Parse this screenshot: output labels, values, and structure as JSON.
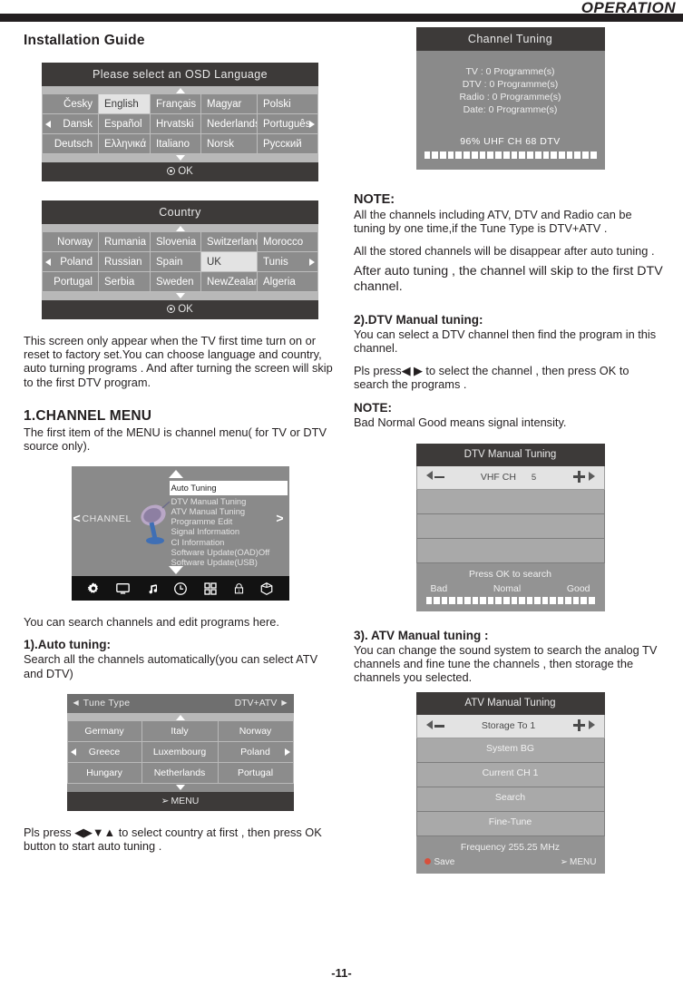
{
  "header": {
    "title": "OPERATION"
  },
  "page_number": "-11-",
  "left": {
    "section_title": "Installation Guide",
    "language_panel": {
      "title": "Please select an OSD Language",
      "rows": [
        [
          "Česky",
          "English",
          "Français",
          "Magyar",
          "Polski"
        ],
        [
          "Dansk",
          "Español",
          "Hrvatski",
          "Nederlands",
          "Português"
        ],
        [
          "Deutsch",
          "Ελληνικά",
          "Italiano",
          "Norsk",
          "Русский"
        ]
      ],
      "selected": "English",
      "ok_label": "OK"
    },
    "country_panel": {
      "title": "Country",
      "rows": [
        [
          "Norway",
          "Rumania",
          "Slovenia",
          "Switzerland",
          "Morocco"
        ],
        [
          "Poland",
          "Russian",
          "Spain",
          "UK",
          "Tunis"
        ],
        [
          "Portugal",
          "Serbia",
          "Sweden",
          "NewZealand",
          "Algeria"
        ]
      ],
      "selected": "UK",
      "ok_label": "OK"
    },
    "intro_paragraph": "This screen only appear when the TV first time turn on or reset to factory set.You can choose language and country, auto turning programs . And after turning the screen will  skip to the first DTV program.",
    "channel_menu_heading": "1.CHANNEL MENU",
    "channel_menu_intro": "The first item of the MENU is channel menu( for TV or DTV source only).",
    "channel_menu_osd": {
      "left_label": "CHANNEL",
      "items": [
        "Auto Tuning",
        "DTV Manual Tuning",
        "ATV Manual Tuning",
        "Programme Edit",
        "Signal Information",
        "CI Information",
        "Software Update(OAD)Off",
        "Software Update(USB)"
      ],
      "selected": "Auto Tuning",
      "icons": [
        "gear-icon",
        "screen-icon",
        "music-note-icon",
        "clock-icon",
        "grid-icon",
        "lock-icon",
        "cube-icon"
      ]
    },
    "after_menu_text": "You can search  channels and edit programs  here.",
    "auto_tuning_heading": "1).Auto tuning:",
    "auto_tuning_text": "Search all the channels automatically(you can select ATV and DTV)",
    "tune_type_panel": {
      "label": "Tune Type",
      "value": "DTV+ATV",
      "rows": [
        [
          "Germany",
          "Italy",
          "Norway"
        ],
        [
          "Greece",
          "Luxembourg",
          "Poland"
        ],
        [
          "Hungary",
          "Netherlands",
          "Portugal"
        ]
      ],
      "menu_label": "MENU"
    },
    "closing_text": "Pls press ◀▶▼▲ to select  country at first , then press OK button to start auto tuning ."
  },
  "right": {
    "channel_tuning_panel": {
      "title": "Channel Tuning",
      "lines": [
        "TV   : 0 Programme(s)",
        "DTV : 0 Programme(s)",
        "Radio : 0 Programme(s)",
        "Date:  0 Programme(s)"
      ],
      "status": "96%   UHF   CH   68 DTV",
      "progress_percent": 96
    },
    "note1_heading": "NOTE:",
    "note1_text": "All the channels including ATV,  DTV and Radio can be tuning by one time,if the Tune Type is DTV+ATV .",
    "note2_text": "All the stored channels will be disappear after auto tuning .",
    "note3_text": "After auto tuning , the channel will skip to the first DTV channel.",
    "dtv_heading": "2).DTV Manual tuning:",
    "dtv_text": "You can select a DTV channel then  find the program in this channel.",
    "dtv_press_text": "Pls press◀ ▶ to select the channel , then press OK to search the programs .",
    "note4_heading": "NOTE:",
    "note4_text": "Bad Normal Good means signal intensity.",
    "dtv_manual_panel": {
      "title": "DTV Manual Tuning",
      "active_label": "VHF CH",
      "active_value": "5",
      "empty_rows": 3,
      "footer": "Press OK to search",
      "signal_labels": [
        "Bad",
        "Nomal",
        "Good"
      ]
    },
    "atv_heading": "3). ATV  Manual tuning :",
    "atv_text": "You can change the sound system to search the analog TV channels and fine tune the channels , then storage the channels you selected.",
    "atv_manual_panel": {
      "title": "ATV Manual Tuning",
      "active_label": "Storage To 1",
      "rows": [
        "System BG",
        "Current CH 1",
        "Search",
        "Fine-Tune"
      ],
      "frequency": "Frequency  255.25  MHz",
      "save_label": "Save",
      "menu_label": "MENU"
    }
  },
  "colors": {
    "ink": "#231f20",
    "osd_title_bg": "#3d3a39",
    "osd_cell_bg": "#8c8c8c",
    "osd_selected_bg": "#e3e3e3",
    "save_red": "#d8503c"
  }
}
